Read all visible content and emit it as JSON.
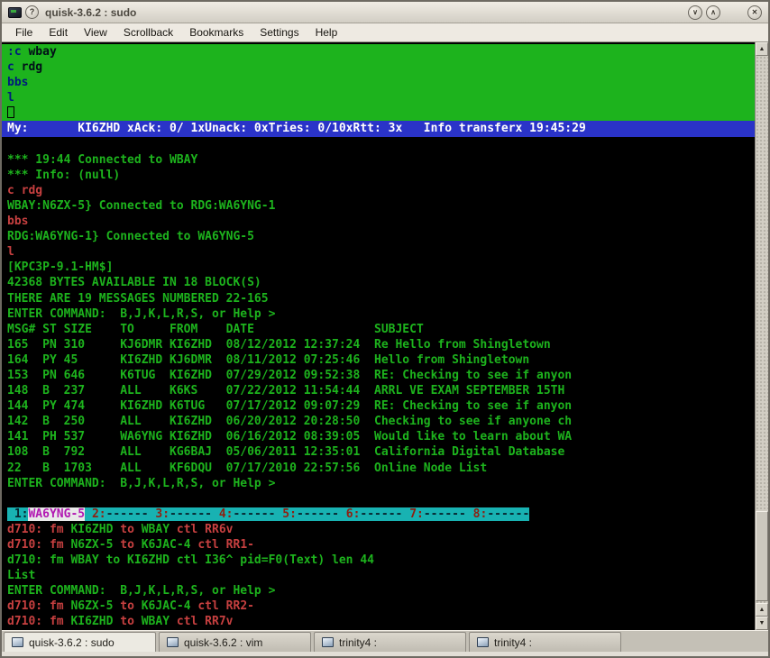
{
  "window": {
    "title": "quisk-3.6.2 : sudo",
    "buttons": {
      "help": "?",
      "minimize": "∨",
      "maximize": "∧",
      "close": "✕"
    }
  },
  "menubar": {
    "items": [
      "File",
      "Edit",
      "View",
      "Scrollback",
      "Bookmarks",
      "Settings",
      "Help"
    ]
  },
  "scrollbar": {
    "up": "▲",
    "down": "▼"
  },
  "colors": {
    "terminal_green": "#1db31d",
    "terminal_red": "#c74040",
    "status_blue": "#2a33c8",
    "channel_cyan": "#18b2b2",
    "channel_magenta": "#b218b2",
    "input_area_green_bg": "#1db31d",
    "terminal_bg": "#000000"
  },
  "terminal": {
    "lines": [
      {
        "bg": "grn",
        "name": "input-echo-line",
        "seg": [
          {
            "t": ":c",
            "c": "nav"
          },
          {
            "t": " wbay",
            "c": "blk"
          }
        ]
      },
      {
        "bg": "grn",
        "name": "input-echo-line",
        "seg": [
          {
            "t": "c",
            "c": "nav"
          },
          {
            "t": " rdg",
            "c": "blk"
          }
        ]
      },
      {
        "bg": "grn",
        "name": "input-echo-line",
        "seg": [
          {
            "t": "bbs",
            "c": "nav"
          }
        ]
      },
      {
        "bg": "grn",
        "name": "input-echo-line",
        "seg": [
          {
            "t": "l",
            "c": "nav"
          }
        ]
      },
      {
        "bg": "grn",
        "name": "input-cursor-line",
        "seg": [
          {
            "cursor": true
          }
        ]
      },
      {
        "bg": "blu",
        "name": "link-status-bar",
        "seg": [
          {
            "t": "My:       KI6ZHD xAck: 0/ 1xUnack: 0xTries: 0/10xRtt: 3x   Info transferx 19:45:29",
            "c": "wht"
          }
        ]
      },
      {
        "seg": []
      },
      {
        "seg": [
          {
            "t": "*** 19:44 Connected to WBAY",
            "c": "grn"
          }
        ]
      },
      {
        "seg": [
          {
            "t": "*** Info: (null)",
            "c": "grn"
          }
        ]
      },
      {
        "seg": [
          {
            "t": "c rdg",
            "c": "red"
          }
        ]
      },
      {
        "seg": [
          {
            "t": "WBAY:N6ZX-5} Connected to RDG:WA6YNG-1",
            "c": "grn"
          }
        ]
      },
      {
        "seg": [
          {
            "t": "bbs",
            "c": "red"
          }
        ]
      },
      {
        "seg": [
          {
            "t": "RDG:WA6YNG-1} Connected to WA6YNG-5",
            "c": "grn"
          }
        ]
      },
      {
        "seg": [
          {
            "t": "l",
            "c": "red"
          }
        ]
      },
      {
        "seg": [
          {
            "t": "[KPC3P-9.1-HM$]",
            "c": "grn"
          }
        ]
      },
      {
        "seg": [
          {
            "t": "42368 BYTES AVAILABLE IN 18 BLOCK(S)",
            "c": "grn"
          }
        ]
      },
      {
        "seg": [
          {
            "t": "THERE ARE 19 MESSAGES NUMBERED 22-165",
            "c": "grn"
          }
        ]
      },
      {
        "seg": [
          {
            "t": "ENTER COMMAND:  B,J,K,L,R,S, or Help >",
            "c": "grn"
          }
        ]
      },
      {
        "seg": [
          {
            "t": "MSG# ST SIZE    TO     FROM    DATE                 SUBJECT",
            "c": "grn"
          }
        ]
      },
      {
        "seg": [
          {
            "t": "165  PN 310     KJ6DMR KI6ZHD  08/12/2012 12:37:24  Re Hello from Shingletown",
            "c": "grn"
          }
        ]
      },
      {
        "seg": [
          {
            "t": "164  PY 45      KI6ZHD KJ6DMR  08/11/2012 07:25:46  Hello from Shingletown",
            "c": "grn"
          }
        ]
      },
      {
        "seg": [
          {
            "t": "153  PN 646     K6TUG  KI6ZHD  07/29/2012 09:52:38  RE: Checking to see if anyon",
            "c": "grn"
          }
        ]
      },
      {
        "seg": [
          {
            "t": "148  B  237     ALL    K6KS    07/22/2012 11:54:44  ARRL VE EXAM SEPTEMBER 15TH",
            "c": "grn"
          }
        ]
      },
      {
        "seg": [
          {
            "t": "144  PY 474     KI6ZHD K6TUG   07/17/2012 09:07:29  RE: Checking to see if anyon",
            "c": "grn"
          }
        ]
      },
      {
        "seg": [
          {
            "t": "142  B  250     ALL    KI6ZHD  06/20/2012 20:28:50  Checking to see if anyone ch",
            "c": "grn"
          }
        ]
      },
      {
        "seg": [
          {
            "t": "141  PH 537     WA6YNG KI6ZHD  06/16/2012 08:39:05  Would like to learn about WA",
            "c": "grn"
          }
        ]
      },
      {
        "seg": [
          {
            "t": "108  B  792     ALL    KG6BAJ  05/06/2011 12:35:01  California Digital Database",
            "c": "grn"
          }
        ]
      },
      {
        "seg": [
          {
            "t": "22   B  1703    ALL    KF6DQU  07/17/2010 22:57:56  Online Node List",
            "c": "grn"
          }
        ]
      },
      {
        "seg": [
          {
            "t": "ENTER COMMAND:  B,J,K,L,R,S, or Help >",
            "c": "grn"
          }
        ]
      },
      {
        "seg": []
      },
      {
        "name": "channel-status-bar",
        "seg": [
          {
            "t": " 1:",
            "c": "cb"
          },
          {
            "t": "WA6YNG-5",
            "c": "mag"
          },
          {
            "t": " ",
            "c": "cb"
          },
          {
            "t": "2:",
            "c": "cr"
          },
          {
            "t": "------ ",
            "c": "cb"
          },
          {
            "t": "3:",
            "c": "cr"
          },
          {
            "t": "------ ",
            "c": "cb"
          },
          {
            "t": "4:",
            "c": "cr"
          },
          {
            "t": "------ ",
            "c": "cb"
          },
          {
            "t": "5:",
            "c": "cr"
          },
          {
            "t": "------ ",
            "c": "cb"
          },
          {
            "t": "6:",
            "c": "cr"
          },
          {
            "t": "------ ",
            "c": "cb"
          },
          {
            "t": "7:",
            "c": "cr"
          },
          {
            "t": "------ ",
            "c": "cb"
          },
          {
            "t": "8:",
            "c": "cr"
          },
          {
            "t": "------",
            "c": "cb"
          }
        ]
      },
      {
        "seg": [
          {
            "t": "d710: fm ",
            "c": "red"
          },
          {
            "t": "KI6ZHD",
            "c": "grn"
          },
          {
            "t": " to ",
            "c": "red"
          },
          {
            "t": "WBAY",
            "c": "grn"
          },
          {
            "t": " ctl RR6v",
            "c": "red"
          }
        ]
      },
      {
        "seg": [
          {
            "t": "d710: fm ",
            "c": "red"
          },
          {
            "t": "N6ZX-5",
            "c": "grn"
          },
          {
            "t": " to ",
            "c": "red"
          },
          {
            "t": "K6JAC-4",
            "c": "grn"
          },
          {
            "t": " ctl RR1-",
            "c": "red"
          }
        ]
      },
      {
        "seg": [
          {
            "t": "d710: fm WBAY to KI6ZHD ctl I36^ pid=F0(Text) len 44",
            "c": "grn"
          }
        ]
      },
      {
        "seg": [
          {
            "t": "List",
            "c": "grn"
          }
        ]
      },
      {
        "seg": [
          {
            "t": "ENTER COMMAND:  B,J,K,L,R,S, or Help >",
            "c": "grn"
          }
        ]
      },
      {
        "seg": [
          {
            "t": "d710: fm ",
            "c": "red"
          },
          {
            "t": "N6ZX-5",
            "c": "grn"
          },
          {
            "t": " to ",
            "c": "red"
          },
          {
            "t": "K6JAC-4",
            "c": "grn"
          },
          {
            "t": " ctl RR2-",
            "c": "red"
          }
        ]
      },
      {
        "seg": [
          {
            "t": "d710: fm ",
            "c": "red"
          },
          {
            "t": "KI6ZHD",
            "c": "grn"
          },
          {
            "t": " to ",
            "c": "red"
          },
          {
            "t": "WBAY",
            "c": "grn"
          },
          {
            "t": " ctl RR7v",
            "c": "red"
          }
        ]
      }
    ]
  },
  "tabbar": {
    "tabs": [
      {
        "label": "quisk-3.6.2 : sudo",
        "active": true
      },
      {
        "label": "quisk-3.6.2 : vim",
        "active": false
      },
      {
        "label": "trinity4 :",
        "active": false
      },
      {
        "label": "trinity4 :",
        "active": false
      }
    ]
  }
}
